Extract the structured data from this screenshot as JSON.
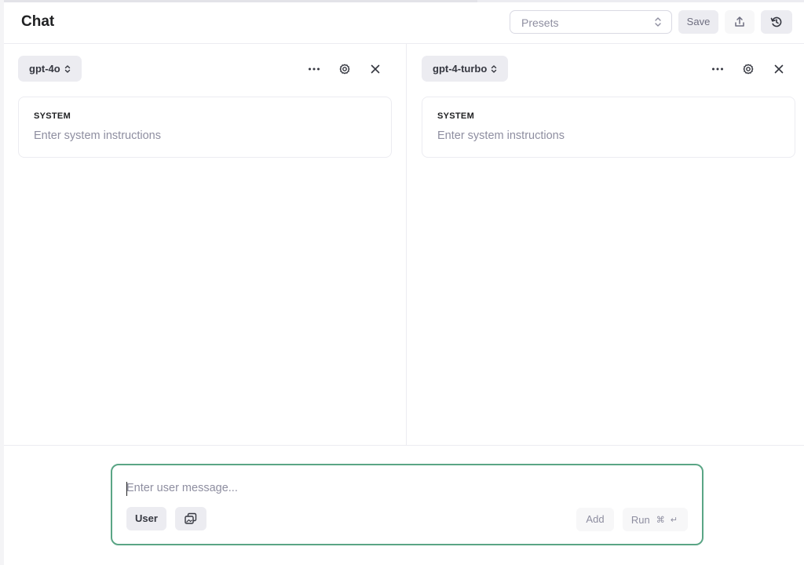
{
  "header": {
    "title": "Chat",
    "presets": {
      "value": "Presets"
    },
    "save_label": "Save",
    "share_icon": "upload-icon",
    "history_icon": "history-icon"
  },
  "panels": [
    {
      "model": "gpt-4o",
      "system_label": "SYSTEM",
      "system_placeholder": "Enter system instructions"
    },
    {
      "model": "gpt-4-turbo",
      "system_label": "SYSTEM",
      "system_placeholder": "Enter system instructions"
    }
  ],
  "composer": {
    "placeholder": "Enter user message...",
    "role_label": "User",
    "add_label": "Add",
    "run_label": "Run",
    "run_shortcut": "⌘ ↵"
  },
  "colors": {
    "composer_border": "#5aa585",
    "button_bg": "#ececf1",
    "placeholder": "#8e8ea0"
  }
}
